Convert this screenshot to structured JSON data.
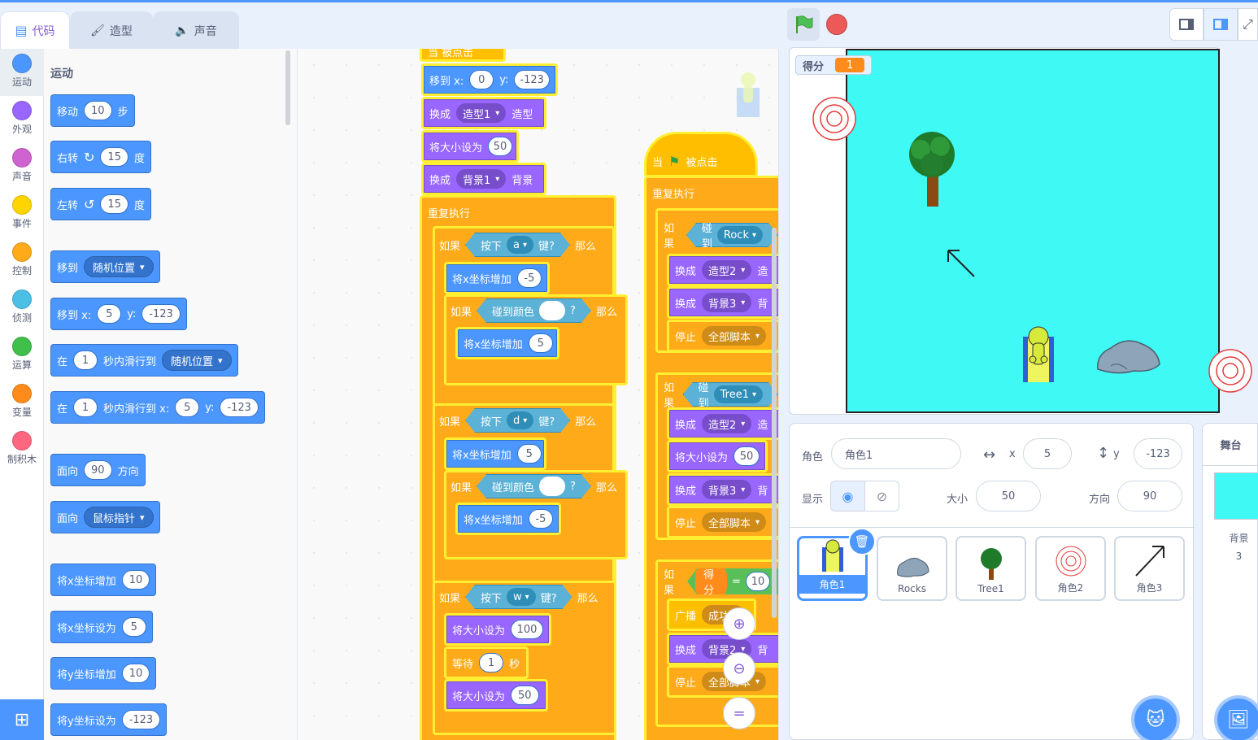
{
  "tabs": {
    "code": "代码",
    "costumes": "造型",
    "sounds": "声音"
  },
  "categories": [
    {
      "label": "运动",
      "color": "#4c97ff"
    },
    {
      "label": "外观",
      "color": "#9966ff"
    },
    {
      "label": "声音",
      "color": "#cf63cf"
    },
    {
      "label": "事件",
      "color": "#ffd500"
    },
    {
      "label": "控制",
      "color": "#ffab19"
    },
    {
      "label": "侦测",
      "color": "#4cbfe6"
    },
    {
      "label": "运算",
      "color": "#40bf4a"
    },
    {
      "label": "变量",
      "color": "#ff8c1a"
    },
    {
      "label": "制积木",
      "color": "#ff6680"
    }
  ],
  "palette": {
    "title": "运动",
    "move": {
      "pre": "移动",
      "val": "10",
      "post": "步"
    },
    "turn_right": {
      "pre": "右转",
      "val": "15",
      "post": "度"
    },
    "turn_left": {
      "pre": "左转",
      "val": "15",
      "post": "度"
    },
    "goto": {
      "pre": "移到",
      "dd": "随机位置"
    },
    "goto_xy": {
      "pre": "移到 x:",
      "x": "5",
      "ylabel": "y:",
      "y": "-123"
    },
    "glide": {
      "pre": "在",
      "val": "1",
      "mid": "秒内滑行到",
      "dd": "随机位置"
    },
    "glide_xy": {
      "pre": "在",
      "val": "1",
      "mid": "秒内滑行到 x:",
      "x": "5",
      "ylabel": "y:",
      "y": "-123"
    },
    "point": {
      "pre": "面向",
      "val": "90",
      "post": "方向"
    },
    "point_towards": {
      "pre": "面向",
      "dd": "鼠标指针"
    },
    "change_x": {
      "pre": "将x坐标增加",
      "val": "10"
    },
    "set_x": {
      "pre": "将x坐标设为",
      "val": "5"
    },
    "change_y": {
      "pre": "将y坐标增加",
      "val": "10"
    },
    "set_y": {
      "pre": "将y坐标设为",
      "val": "-123"
    }
  },
  "script1": {
    "hat_top": "当 被点击",
    "goto": {
      "pre": "移到 x:",
      "x": "0",
      "ylabel": "y:",
      "y": "-123"
    },
    "costume": {
      "pre": "换成",
      "dd": "造型1",
      "post": "造型"
    },
    "size": {
      "pre": "将大小设为",
      "val": "50"
    },
    "backdrop": {
      "pre": "换成",
      "dd": "背景1",
      "post": "背景"
    },
    "forever": "重复执行",
    "if_a": {
      "pre": "如果",
      "key_pre": "按下",
      "key": "a",
      "key_post": "键?",
      "post": "那么"
    },
    "change_x_neg": {
      "pre": "将x坐标增加",
      "val": "-5"
    },
    "if_color1": {
      "pre": "如果",
      "touch": "碰到颜色",
      "q": "?",
      "post": "那么"
    },
    "change_x_pos": {
      "pre": "将x坐标增加",
      "val": "5"
    },
    "if_d": {
      "pre": "如果",
      "key_pre": "按下",
      "key": "d",
      "key_post": "键?",
      "post": "那么"
    },
    "change_x_d": {
      "pre": "将x坐标增加",
      "val": "5"
    },
    "if_color2": {
      "pre": "如果",
      "touch": "碰到颜色",
      "q": "?",
      "post": "那么"
    },
    "change_x_d2": {
      "pre": "将x坐标增加",
      "val": "-5"
    },
    "if_w": {
      "pre": "如果",
      "key_pre": "按下",
      "key": "w",
      "key_post": "键?",
      "post": "那么"
    },
    "size_100": {
      "pre": "将大小设为",
      "val": "100"
    },
    "wait": {
      "pre": "等待",
      "val": "1",
      "post": "秒"
    },
    "size_50": {
      "pre": "将大小设为",
      "val": "50"
    }
  },
  "script2": {
    "hat": {
      "pre": "当",
      "post": "被点击"
    },
    "forever": "重复执行",
    "if_rock": {
      "pre": "如果",
      "touch": "碰到",
      "dd": "Rock"
    },
    "costume2": {
      "pre": "换成",
      "dd": "造型2",
      "post": "造"
    },
    "backdrop3": {
      "pre": "换成",
      "dd": "背景3",
      "post": "背"
    },
    "stop": {
      "pre": "停止",
      "dd": "全部脚本"
    },
    "if_tree": {
      "pre": "如果",
      "touch": "碰到",
      "dd": "Tree1"
    },
    "costume2b": {
      "pre": "换成",
      "dd": "造型2",
      "post": "造"
    },
    "size50": {
      "pre": "将大小设为",
      "val": "50"
    },
    "backdrop3b": {
      "pre": "换成",
      "dd": "背景3",
      "post": "背"
    },
    "stop2": {
      "pre": "停止",
      "dd": "全部脚本"
    },
    "if_score": {
      "pre": "如果",
      "var": "得分",
      "eq": "=",
      "val": "10"
    },
    "broadcast": {
      "pre": "广播",
      "dd": "成功"
    },
    "backdrop2": {
      "pre": "换成",
      "dd": "背景2",
      "post": "背"
    },
    "stop3": {
      "pre": "停止",
      "dd": "全部脚本"
    }
  },
  "stage": {
    "monitor_label": "得分",
    "monitor_value": "1"
  },
  "sprite_info": {
    "sprite_label": "角色",
    "sprite_name": "角色1",
    "x_label": "x",
    "x_value": "5",
    "y_label": "y",
    "y_value": "-123",
    "show_label": "显示",
    "size_label": "大小",
    "size_value": "50",
    "direction_label": "方向",
    "direction_value": "90"
  },
  "sprites": [
    {
      "name": "角色1",
      "icon": "robot-sprite-icon"
    },
    {
      "name": "Rocks",
      "icon": "rock-sprite-icon"
    },
    {
      "name": "Tree1",
      "icon": "tree-sprite-icon"
    },
    {
      "name": "角色2",
      "icon": "target-sprite-icon"
    },
    {
      "name": "角色3",
      "icon": "arrow-sprite-icon"
    }
  ],
  "stage_panel": {
    "title": "舞台",
    "backdrop_label": "背景",
    "backdrop_count": "3"
  }
}
